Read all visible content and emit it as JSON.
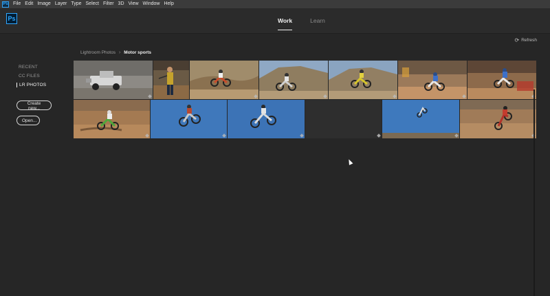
{
  "menubar": {
    "app_icon": "Ps",
    "items": [
      "File",
      "Edit",
      "Image",
      "Layer",
      "Type",
      "Select",
      "Filter",
      "3D",
      "View",
      "Window",
      "Help"
    ]
  },
  "header": {
    "logo": "Ps",
    "tabs": [
      {
        "label": "Work",
        "active": true
      },
      {
        "label": "Learn",
        "active": false
      }
    ]
  },
  "refresh": {
    "icon": "refresh-icon",
    "label": "Refresh"
  },
  "sidebar": {
    "links": [
      {
        "label": "RECENT",
        "active": false
      },
      {
        "label": "CC FILES",
        "active": false
      },
      {
        "label": "LR PHOTOS",
        "active": true
      }
    ],
    "create_label": "Create new...",
    "open_label": "Open..."
  },
  "breadcrumb": {
    "parent": "Lightroom Photos",
    "separator": "›",
    "current": "Motor sports"
  },
  "photos": {
    "row1": [
      "truck-dirt",
      "man-flag",
      "moto-hill-1",
      "moto-hill-2",
      "moto-hill-3",
      "moto-race-1",
      "moto-race-2"
    ],
    "row2": [
      "moto-dirt-green",
      "moto-sky-1",
      "moto-sky-2",
      "empty",
      "moto-sky-3",
      "moto-dirt-red"
    ]
  },
  "colors": {
    "background": "#262626",
    "accent": "#31a8ff",
    "sky": "#3f76b8",
    "dirt": "#a0734a"
  }
}
